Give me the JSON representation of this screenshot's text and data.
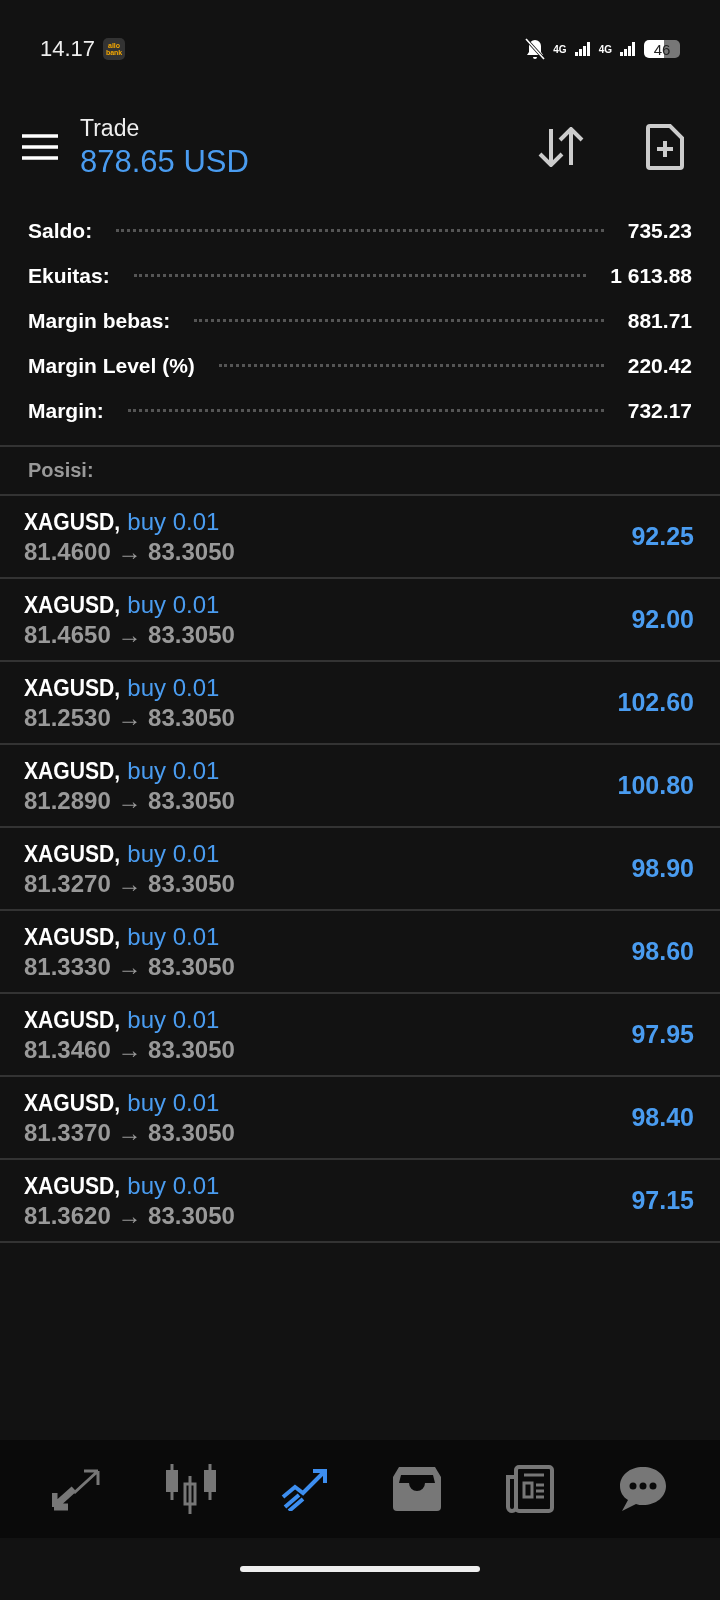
{
  "status_bar": {
    "time": "14.17",
    "app_badge": "allo bank",
    "network_1": "4G",
    "network_2": "4G",
    "battery": "46"
  },
  "header": {
    "title": "Trade",
    "balance": "878.65 USD"
  },
  "summary": [
    {
      "label": "Saldo:",
      "value": "735.23"
    },
    {
      "label": "Ekuitas:",
      "value": "1 613.88"
    },
    {
      "label": "Margin bebas:",
      "value": "881.71"
    },
    {
      "label": "Margin Level (%)",
      "value": "220.42"
    },
    {
      "label": "Margin:",
      "value": "732.17"
    }
  ],
  "positions_title": "Posisi:",
  "positions": [
    {
      "symbol": "XAGUSD,",
      "side": "buy 0.01",
      "prices": "81.4600 → 83.3050",
      "profit": "92.25"
    },
    {
      "symbol": "XAGUSD,",
      "side": "buy 0.01",
      "prices": "81.4650 → 83.3050",
      "profit": "92.00"
    },
    {
      "symbol": "XAGUSD,",
      "side": "buy 0.01",
      "prices": "81.2530 → 83.3050",
      "profit": "102.60"
    },
    {
      "symbol": "XAGUSD,",
      "side": "buy 0.01",
      "prices": "81.2890 → 83.3050",
      "profit": "100.80"
    },
    {
      "symbol": "XAGUSD,",
      "side": "buy 0.01",
      "prices": "81.3270 → 83.3050",
      "profit": "98.90"
    },
    {
      "symbol": "XAGUSD,",
      "side": "buy 0.01",
      "prices": "81.3330 → 83.3050",
      "profit": "98.60"
    },
    {
      "symbol": "XAGUSD,",
      "side": "buy 0.01",
      "prices": "81.3460 → 83.3050",
      "profit": "97.95"
    },
    {
      "symbol": "XAGUSD,",
      "side": "buy 0.01",
      "prices": "81.3370 → 83.3050",
      "profit": "98.40"
    },
    {
      "symbol": "XAGUSD,",
      "side": "buy 0.01",
      "prices": "81.3620 → 83.3050",
      "profit": "97.15"
    }
  ],
  "bottom_nav": [
    {
      "kind": "quotes",
      "selected": false
    },
    {
      "kind": "chart",
      "selected": false
    },
    {
      "kind": "trade",
      "selected": true
    },
    {
      "kind": "history",
      "selected": false
    },
    {
      "kind": "news",
      "selected": false
    },
    {
      "kind": "chat",
      "selected": false
    }
  ]
}
